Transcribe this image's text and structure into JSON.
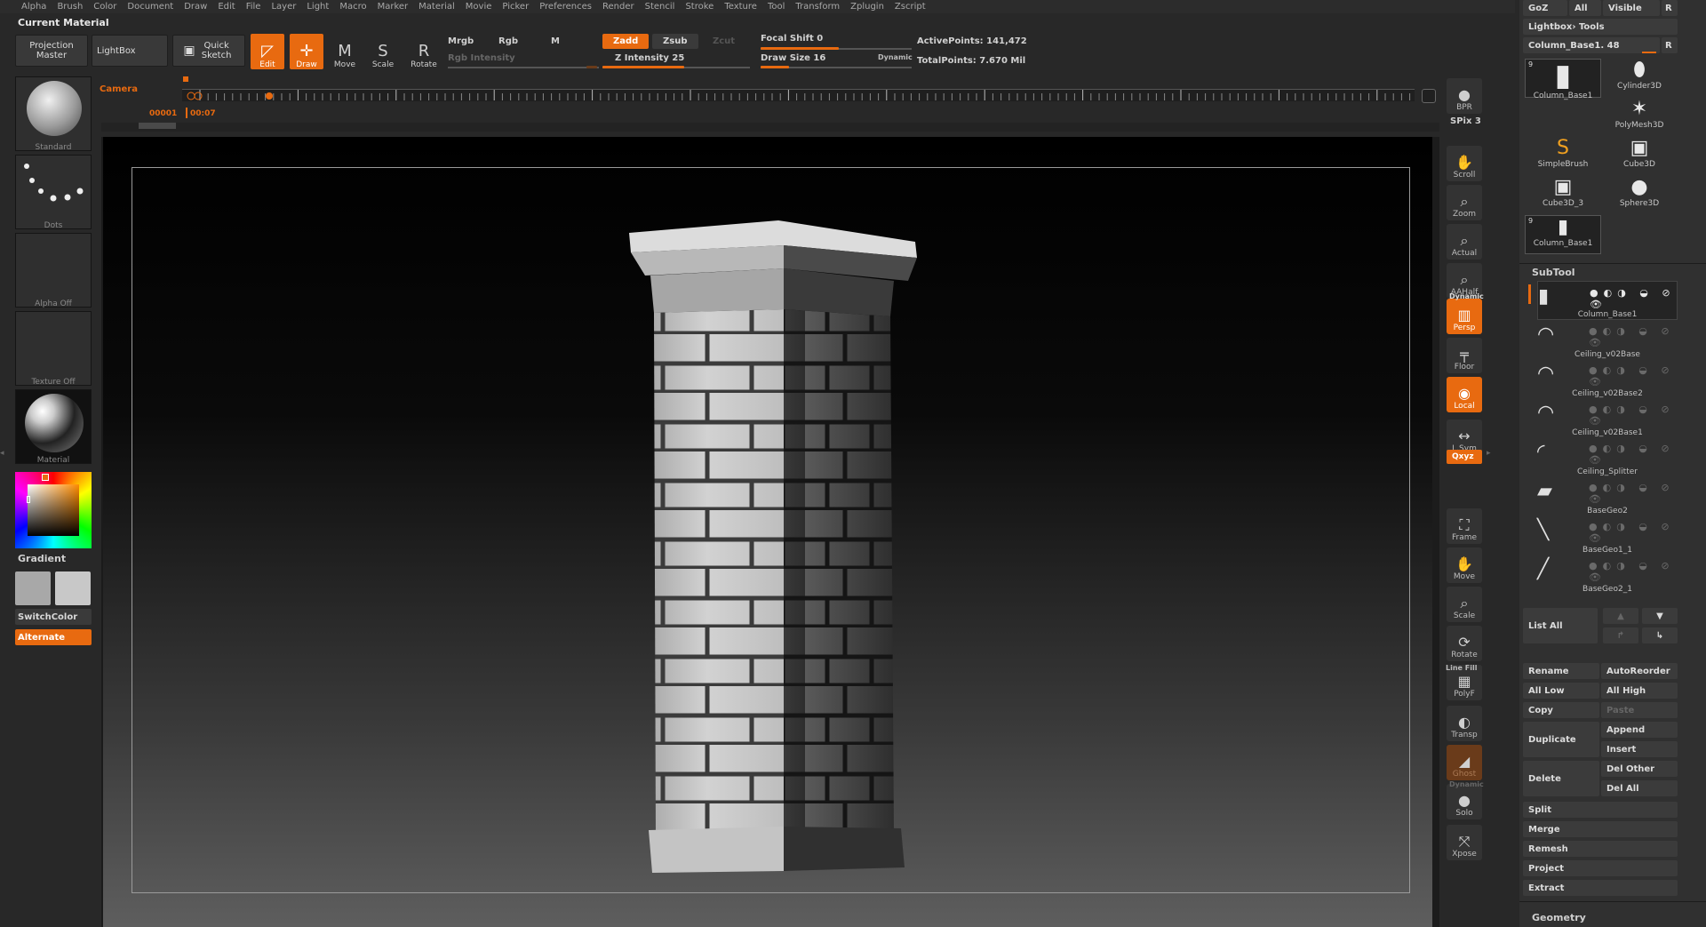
{
  "menu": [
    "Alpha",
    "Brush",
    "Color",
    "Document",
    "Draw",
    "Edit",
    "File",
    "Layer",
    "Light",
    "Macro",
    "Marker",
    "Material",
    "Movie",
    "Picker",
    "Preferences",
    "Render",
    "Stencil",
    "Stroke",
    "Texture",
    "Tool",
    "Transform",
    "Zplugin",
    "Zscript"
  ],
  "current_material": "Current Material",
  "toolbar": {
    "projection_master": "Projection Master",
    "lightbox": "LightBox",
    "quick_sketch": "Quick Sketch",
    "edit": "Edit",
    "draw": "Draw",
    "move": "Move",
    "scale": "Scale",
    "rotate": "Rotate",
    "mrgb": "Mrgb",
    "rgb": "Rgb",
    "m": "M",
    "rgb_intensity": "Rgb Intensity",
    "zadd": "Zadd",
    "zsub": "Zsub",
    "zcut": "Zcut",
    "z_intensity_label": "Z Intensity",
    "z_intensity": "25",
    "focal_shift_label": "Focal Shift",
    "focal_shift": "0",
    "draw_size_label": "Draw Size",
    "draw_size": "16",
    "dynamic": "Dynamic",
    "active_points_label": "ActivePoints:",
    "active_points": "141,472",
    "total_points_label": "TotalPoints:",
    "total_points": "7.670 Mil"
  },
  "timeline": {
    "camera": "Camera",
    "frame": "00001",
    "time": "00:07"
  },
  "left_panel": {
    "standard": "Standard",
    "dots": "Dots",
    "alpha_off": "Alpha Off",
    "texture_off": "Texture Off",
    "material": "Material",
    "gradient": "Gradient",
    "switch_color": "SwitchColor",
    "alternate": "Alternate"
  },
  "shelf": [
    {
      "label": "BPR",
      "icon": "bpr-icon",
      "glyph": "●",
      "style": ""
    },
    {
      "label": "Scroll",
      "icon": "hand-icon",
      "glyph": "✋",
      "style": ""
    },
    {
      "label": "Zoom",
      "icon": "zoom-icon",
      "glyph": "⌕",
      "style": ""
    },
    {
      "label": "Actual",
      "icon": "actual-icon",
      "glyph": "⌕",
      "style": ""
    },
    {
      "label": "AAHalf",
      "icon": "aahalf-icon",
      "glyph": "⌕",
      "style": ""
    },
    {
      "label": "Persp",
      "icon": "perspective-icon",
      "glyph": "▥",
      "style": "orange"
    },
    {
      "label": "Floor",
      "icon": "floor-icon",
      "glyph": "╤",
      "style": ""
    },
    {
      "label": "Local",
      "icon": "local-icon",
      "glyph": "◉",
      "style": "orange"
    },
    {
      "label": "L.Sym",
      "icon": "lsym-icon",
      "glyph": "↔",
      "style": ""
    },
    {
      "label": "Frame",
      "icon": "frame-icon",
      "glyph": "⛶",
      "style": ""
    },
    {
      "label": "Move",
      "icon": "move-hand-icon",
      "glyph": "✋",
      "style": ""
    },
    {
      "label": "Scale",
      "icon": "scale-icon",
      "glyph": "⌕",
      "style": ""
    },
    {
      "label": "Rotate",
      "icon": "rotate-icon",
      "glyph": "⟳",
      "style": ""
    },
    {
      "label": "PolyF",
      "icon": "polyframe-icon",
      "glyph": "▦",
      "style": ""
    },
    {
      "label": "Transp",
      "icon": "transparency-icon",
      "glyph": "◐",
      "style": ""
    },
    {
      "label": "Ghost",
      "icon": "ghost-icon",
      "glyph": "◢",
      "style": "dimorange"
    },
    {
      "label": "Solo",
      "icon": "solo-icon",
      "glyph": "●",
      "style": ""
    },
    {
      "label": "Xpose",
      "icon": "xpose-icon",
      "glyph": "⤧",
      "style": ""
    }
  ],
  "shelf_extra": {
    "spix_label": "SPix",
    "spix": "3",
    "dynamic": "Dynamic",
    "xyz": "Qxyz",
    "line_fill": "Line Fill"
  },
  "right_panel": {
    "goz": "GoZ",
    "all": "All",
    "visible": "Visible",
    "r": "R",
    "lightbox_tools": "Lightbox› Tools",
    "tool_name": "Column_Base1.",
    "tool_value": "48",
    "tools": [
      {
        "name": "Column_Base1",
        "count": "9"
      },
      {
        "name": "Cylinder3D"
      },
      {
        "name": "PolyMesh3D"
      },
      {
        "name": "SimpleBrush"
      },
      {
        "name": "Cube3D"
      },
      {
        "name": "Cube3D_3"
      },
      {
        "name": "Sphere3D"
      },
      {
        "name": "Column_Base1",
        "count": "9"
      }
    ],
    "subtool_header": "SubTool",
    "subtools": [
      "Column_Base1",
      "Ceiling_v02Base",
      "Ceiling_v02Base2",
      "Ceiling_v02Base1",
      "Ceiling_Splitter",
      "BaseGeo2",
      "BaseGeo1_1",
      "BaseGeo2_1"
    ],
    "list_all": "List All",
    "rename": "Rename",
    "auto_reorder": "AutoReorder",
    "all_low": "All Low",
    "all_high": "All High",
    "copy": "Copy",
    "paste": "Paste",
    "duplicate": "Duplicate",
    "append": "Append",
    "insert": "Insert",
    "delete": "Delete",
    "del_other": "Del Other",
    "del_all": "Del All",
    "split": "Split",
    "merge": "Merge",
    "remesh": "Remesh",
    "project": "Project",
    "extract": "Extract",
    "geometry": "Geometry"
  },
  "colors": {
    "accent": "#e86a10",
    "panel": "#303030",
    "button": "#3b3b3b"
  }
}
